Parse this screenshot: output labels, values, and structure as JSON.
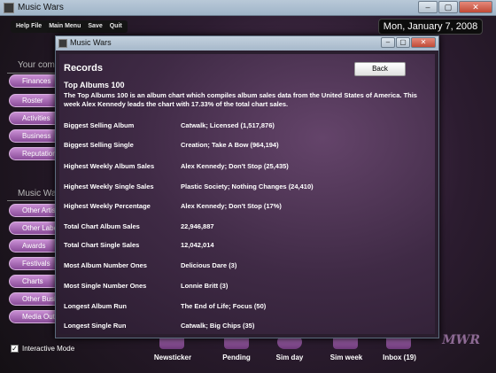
{
  "window": {
    "title": "Music Wars",
    "controls": [
      "–",
      "▢",
      "✕"
    ]
  },
  "menu": {
    "items": [
      "Help File",
      "Main Menu",
      "Save",
      "Quit"
    ]
  },
  "date": "Mon, January 7, 2008",
  "sidebar": {
    "heading1": "Your comp",
    "group1": [
      "Finances",
      "Roster",
      "Activities",
      "Business",
      "Reputation"
    ],
    "heading2": "Music Wars",
    "group2": [
      "Other Artists",
      "Other Labels",
      "Awards",
      "Festivals",
      "Charts",
      "Other Business",
      "Media Outlets"
    ]
  },
  "interactive_mode": {
    "label": "Interactive Mode",
    "checked": true
  },
  "bottom_buttons": [
    "Newsticker",
    "Pending",
    "Sim day",
    "Sim week",
    "Inbox (19)"
  ],
  "logo_text": "MWR",
  "dialog": {
    "title": "Music Wars",
    "heading": "Records",
    "back_label": "Back",
    "subheading": "Top Albums 100",
    "description": "The Top Albums 100 is an album chart which compiles album sales data from the United States of America. This week Alex Kennedy leads the chart with 17.33% of the total chart sales.",
    "records": [
      {
        "label": "Biggest Selling Album",
        "value": "Catwalk; Licensed  (1,517,876)"
      },
      {
        "label": "Biggest Selling Single",
        "value": "Creation; Take A Bow (964,194)"
      },
      {
        "label": "Highest Weekly Album Sales",
        "value": "Alex Kennedy; Don't Stop (25,435)"
      },
      {
        "label": "Highest Weekly Single Sales",
        "value": "Plastic Society; Nothing Changes (24,410)"
      },
      {
        "label": "Highest Weekly Percentage",
        "value": "Alex Kennedy; Don't Stop (17%)"
      },
      {
        "label": "Total Chart Album Sales",
        "value": "22,946,887"
      },
      {
        "label": "Total Chart Single Sales",
        "value": "12,042,014"
      },
      {
        "label": "Most Album Number Ones",
        "value": "Delicious Dare (3)"
      },
      {
        "label": "Most Single Number Ones",
        "value": "Lonnie Britt (3)"
      },
      {
        "label": "Longest Album Run",
        "value": "The End of Life; Focus (50)"
      },
      {
        "label": "Longest Single Run",
        "value": "Catwalk; Big Chips (35)"
      }
    ]
  }
}
